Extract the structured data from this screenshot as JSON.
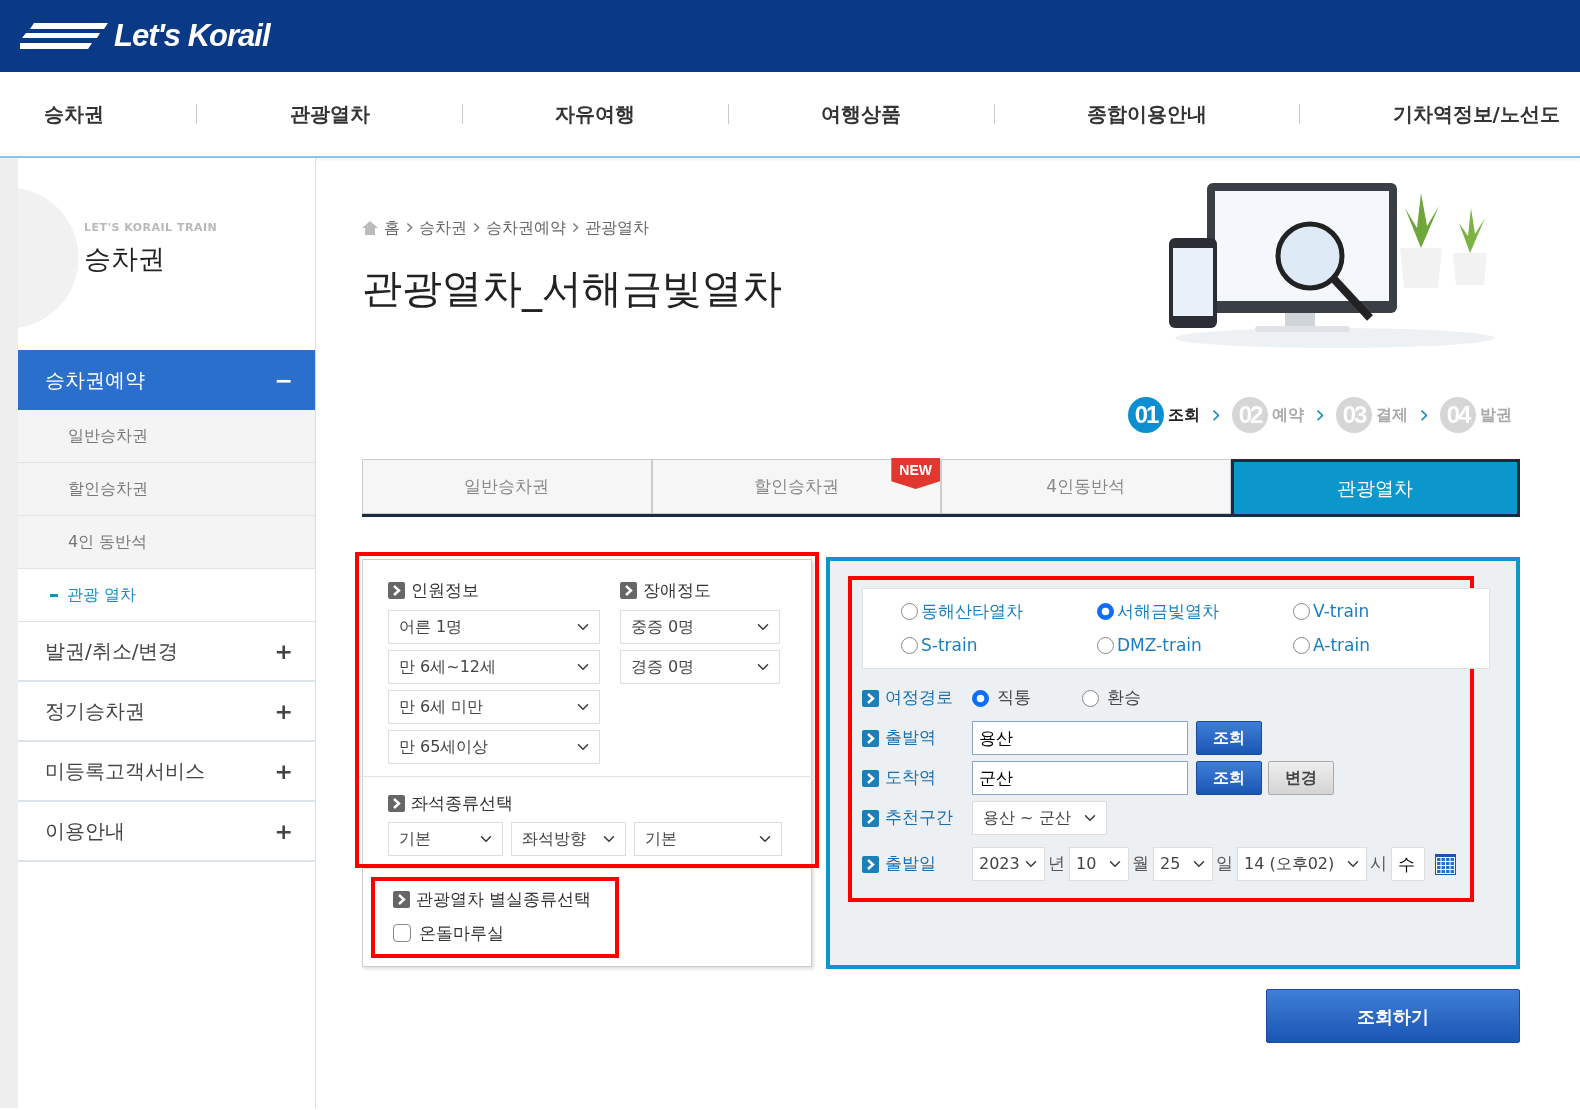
{
  "header": {
    "logo": "Let's Korail"
  },
  "nav": [
    {
      "label": "승차권"
    },
    {
      "label": "관광열차"
    },
    {
      "label": "자유여행"
    },
    {
      "label": "여행상품"
    },
    {
      "label": "종합이용안내"
    },
    {
      "label": "기차역정보/노선도"
    }
  ],
  "sidebar": {
    "caption": "LET'S KORAIL TRAIN",
    "title": "승차권",
    "items": [
      {
        "label": "승차권예약",
        "toggle": "−",
        "expanded": true,
        "children": [
          {
            "label": "일반승차권",
            "selected": false
          },
          {
            "label": "할인승차권",
            "selected": false
          },
          {
            "label": "4인 동반석",
            "selected": false
          },
          {
            "label": "관광 열차",
            "selected": true
          }
        ]
      },
      {
        "label": "발권/취소/변경",
        "toggle": "+",
        "expanded": false
      },
      {
        "label": "정기승차권",
        "toggle": "+",
        "expanded": false
      },
      {
        "label": "미등록고객서비스",
        "toggle": "+",
        "expanded": false
      },
      {
        "label": "이용안내",
        "toggle": "+",
        "expanded": false
      }
    ]
  },
  "breadcrumb": [
    "홈",
    "승차권",
    "승차권예약",
    "관광열차"
  ],
  "title": "관광열차_서해금빛열차",
  "banner": {
    "kind": "picture"
  },
  "steps": [
    {
      "number": "01",
      "label": "조회",
      "selected": true
    },
    {
      "number": "02",
      "label": "예약",
      "selected": false
    },
    {
      "number": "03",
      "label": "결제",
      "selected": false
    },
    {
      "number": "04",
      "label": "발권",
      "selected": false
    }
  ],
  "tabs": [
    {
      "label": "일반승차권",
      "selected": false
    },
    {
      "label": "할인승차권",
      "selected": false,
      "badge": "NEW"
    },
    {
      "label": "4인동반석",
      "selected": false
    },
    {
      "label": "관광열차",
      "selected": true
    }
  ],
  "left_panel": {
    "sections": [
      {
        "highlighted": true,
        "groups": [
          {
            "heading": "인원정보",
            "selects": [
              "어른 1명",
              "만 6세~12세",
              "만 6세 미만",
              "만 65세이상"
            ]
          },
          {
            "heading": "장애정도",
            "selects": [
              "중증 0명",
              "경증 0명"
            ]
          }
        ],
        "seat": {
          "heading": "좌석종류선택",
          "selects": [
            "기본",
            "좌석방향",
            "기본"
          ]
        }
      },
      {
        "highlighted": true,
        "heading": "관광열차 별실종류선택",
        "options": [
          {
            "label": "온돌마루실",
            "checked": false
          }
        ]
      }
    ]
  },
  "right_panel": {
    "highlighted": true,
    "train_types": [
      {
        "label": "동해산타열차",
        "selected": false
      },
      {
        "label": "서해금빛열차",
        "selected": true
      },
      {
        "label": "V-train",
        "selected": false
      },
      {
        "label": "S-train",
        "selected": false
      },
      {
        "label": "DMZ-train",
        "selected": false
      },
      {
        "label": "A-train",
        "selected": false
      }
    ],
    "rows": [
      {
        "kind": "radio",
        "label": "여정경로",
        "options": [
          {
            "label": "직통",
            "selected": true
          },
          {
            "label": "환승",
            "selected": false
          }
        ]
      },
      {
        "kind": "station",
        "label": "출발역",
        "value": "용산",
        "buttons": [
          {
            "label": "조회",
            "primary": true
          }
        ]
      },
      {
        "kind": "station",
        "label": "도착역",
        "value": "군산",
        "buttons": [
          {
            "label": "조회",
            "primary": true
          },
          {
            "label": "변경",
            "primary": false
          }
        ]
      },
      {
        "kind": "select",
        "label": "추천구간",
        "value": "용산 ~ 군산"
      },
      {
        "kind": "date",
        "label": "출발일",
        "parts": [
          {
            "value": "2023",
            "unit": "년"
          },
          {
            "value": "10",
            "unit": "월"
          },
          {
            "value": "25",
            "unit": "일"
          },
          {
            "value": "14 (오후02)",
            "unit": "시"
          }
        ],
        "weekday": "수"
      }
    ]
  },
  "search_button": "조회하기"
}
